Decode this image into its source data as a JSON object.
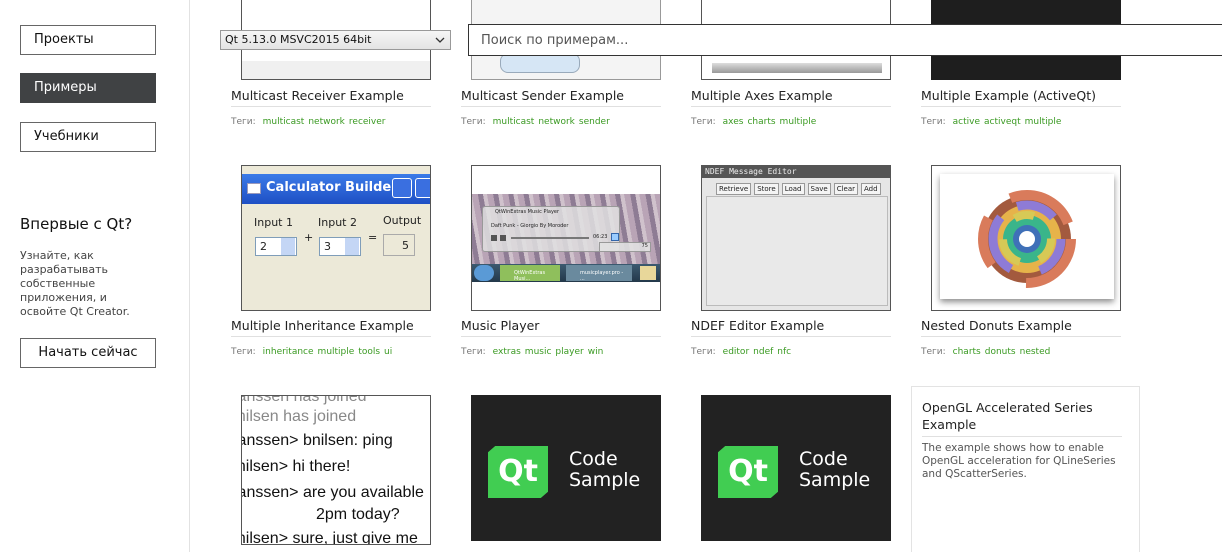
{
  "sidebar": {
    "nav": [
      "Проекты",
      "Примеры",
      "Учебники"
    ],
    "active_index": 1,
    "first_title": "Впервые с Qt?",
    "first_desc": "Узнайте, как разрабатывать собственные приложения, и освойте Qt Creator.",
    "start_button": "Начать сейчас"
  },
  "toolbar": {
    "qt_version": "Qt 5.13.0 MSVC2015 64bit",
    "search_placeholder": "Поиск по примерам..."
  },
  "tags_label": "Теги:",
  "row1": [
    {
      "title": "Multicast Receiver Example",
      "tags": [
        "multicast",
        "network",
        "receiver"
      ]
    },
    {
      "title": "Multicast Sender Example",
      "tags": [
        "multicast",
        "network",
        "sender"
      ]
    },
    {
      "title": "Multiple Axes Example",
      "tags": [
        "axes",
        "charts",
        "multiple"
      ]
    },
    {
      "title": "Multiple Example (ActiveQt)",
      "tags": [
        "active",
        "activeqt",
        "multiple"
      ]
    }
  ],
  "row2": [
    {
      "title": "Multiple Inheritance Example",
      "tags": [
        "inheritance",
        "multiple",
        "tools",
        "ui"
      ]
    },
    {
      "title": "Music Player",
      "tags": [
        "extras",
        "music",
        "player",
        "win"
      ]
    },
    {
      "title": "NDEF Editor Example",
      "tags": [
        "editor",
        "ndef",
        "nfc"
      ]
    },
    {
      "title": "Nested Donuts Example",
      "tags": [
        "charts",
        "donuts",
        "nested"
      ]
    }
  ],
  "thumb_calc": {
    "window_title": "Calculator Builder",
    "input1_label": "Input 1",
    "input2_label": "Input 2",
    "output_label": "Output",
    "input1_value": "2",
    "input2_value": "3",
    "output_value": "5",
    "plus": "+",
    "equals": "="
  },
  "thumb_music": {
    "window_title": "QtWinExtras Music Player",
    "track": "Daft Punk - Giorgio By Moroder",
    "time": "06:23",
    "volume": "75",
    "task1": "QtWinExtras Musi...",
    "task2": "musicplayer.pro - ..."
  },
  "thumb_ndef": {
    "window_title": "NDEF Message Editor",
    "buttons": [
      "Retrieve",
      "Store",
      "Load",
      "Save",
      "Clear",
      "Add"
    ]
  },
  "thumb_chat": {
    "lines": [
      "janssen has joined",
      "bnilsen has joined",
      "janssen> bnilsen: ping",
      "bnilsen> hi there!",
      "janssen> are you available",
      "2pm today?",
      "bnilsen> sure, just give me"
    ]
  },
  "thumb_code": {
    "logo": "Qt",
    "line1": "Code",
    "line2": "Sample"
  },
  "opengl": {
    "title": "OpenGL Accelerated Series Example",
    "desc": "The example shows how to enable OpenGL acceleration for QLineSeries and QScatterSeries."
  },
  "colors": {
    "accent": "#41cd52",
    "tag": "#3a9a22",
    "active_nav": "#404244"
  }
}
